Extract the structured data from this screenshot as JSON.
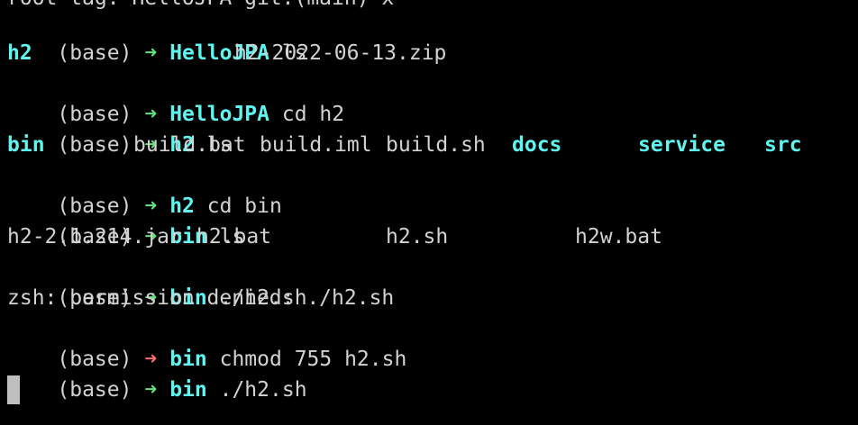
{
  "terminal": {
    "partial_top": "root tag: HelloJPA git:(main) x",
    "prompt_env": "(base)",
    "arrow": "➜",
    "colors": {
      "background": "#000000",
      "text": "#d2d2d2",
      "cwd": "#5ff5f0",
      "arrow_ok": "#5fe37a",
      "arrow_error": "#ff6f6f",
      "cursor": "#bfbfbf"
    },
    "lines": [
      {
        "type": "prompt",
        "cwd": "HelloJPA",
        "cmd": "ls",
        "status": "ok"
      },
      {
        "type": "listing",
        "items": [
          {
            "text": "h2",
            "kind": "dir"
          },
          {
            "text": "h2-2022-06-13.zip",
            "kind": "file"
          }
        ]
      },
      {
        "type": "prompt",
        "cwd": "HelloJPA",
        "cmd": "cd h2",
        "status": "ok"
      },
      {
        "type": "prompt",
        "cwd": "h2",
        "cmd": "ls",
        "status": "ok"
      },
      {
        "type": "listing",
        "items": [
          {
            "text": "bin",
            "kind": "dir"
          },
          {
            "text": "build.bat",
            "kind": "file"
          },
          {
            "text": "build.iml",
            "kind": "file"
          },
          {
            "text": "build.sh",
            "kind": "file"
          },
          {
            "text": "docs",
            "kind": "dir"
          },
          {
            "text": "service",
            "kind": "dir"
          },
          {
            "text": "src",
            "kind": "dir"
          }
        ]
      },
      {
        "type": "prompt",
        "cwd": "h2",
        "cmd": "cd bin",
        "status": "ok"
      },
      {
        "type": "prompt",
        "cwd": "bin",
        "cmd": "ls",
        "status": "ok"
      },
      {
        "type": "listing",
        "items": [
          {
            "text": "h2-2.1.214.jar",
            "kind": "file"
          },
          {
            "text": "h2.bat",
            "kind": "file"
          },
          {
            "text": "h2.sh",
            "kind": "file"
          },
          {
            "text": "h2w.bat",
            "kind": "file"
          }
        ]
      },
      {
        "type": "prompt",
        "cwd": "bin",
        "cmd": "./h2.sh",
        "status": "ok"
      },
      {
        "type": "error",
        "text": "zsh: permission denied: ./h2.sh"
      },
      {
        "type": "prompt",
        "cwd": "bin",
        "cmd": "chmod 755 h2.sh",
        "status": "error"
      },
      {
        "type": "prompt",
        "cwd": "bin",
        "cmd": "./h2.sh",
        "status": "ok"
      }
    ]
  }
}
